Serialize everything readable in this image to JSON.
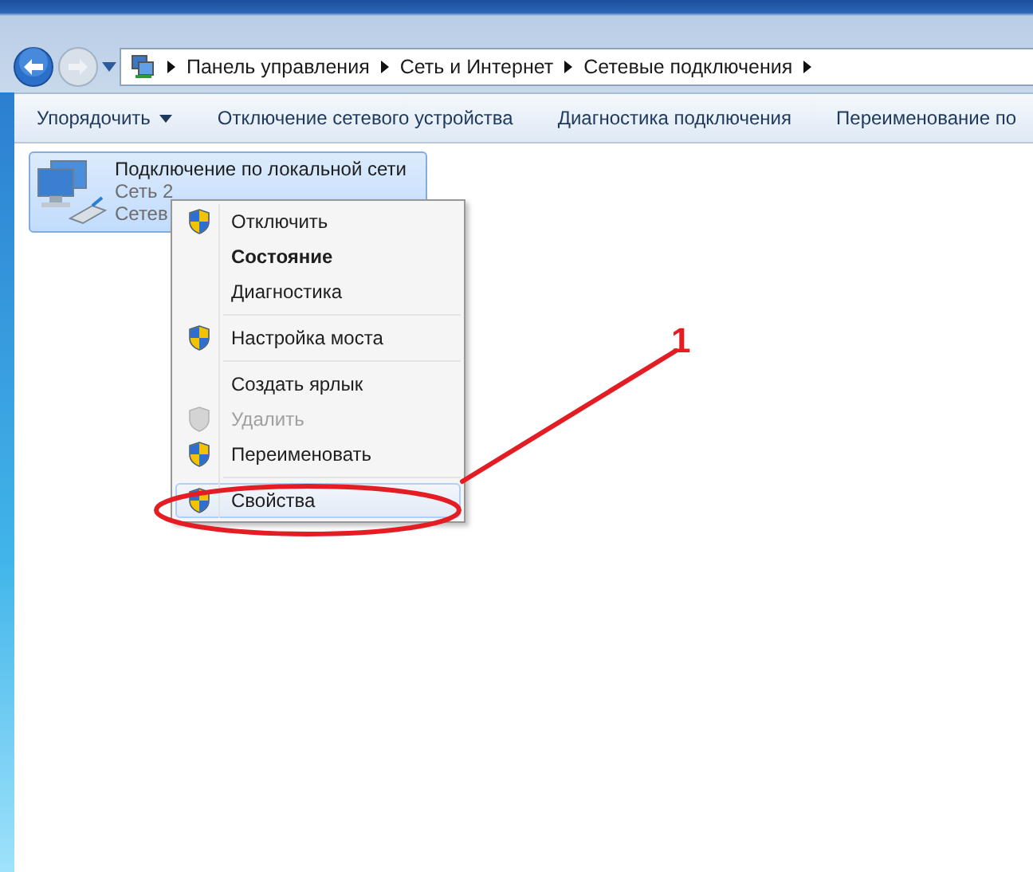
{
  "address_bar": {
    "breadcrumbs": [
      "Панель управления",
      "Сеть и Интернет",
      "Сетевые подключения"
    ]
  },
  "toolbar": {
    "buttons": [
      {
        "label": "Упорядочить",
        "dropdown": true
      },
      {
        "label": "Отключение сетевого устройства",
        "dropdown": false
      },
      {
        "label": "Диагностика подключения",
        "dropdown": false
      },
      {
        "label": "Переименование по",
        "dropdown": false
      }
    ]
  },
  "connection": {
    "name": "Подключение по локальной сети",
    "network": "Сеть  2",
    "detail": "Сетев",
    "selected": true
  },
  "context_menu": {
    "groups": [
      [
        {
          "label": "Отключить",
          "kind": "shield",
          "bold": false,
          "disabled": false,
          "selected": false
        },
        {
          "label": "Состояние",
          "kind": "plain",
          "bold": true,
          "disabled": false,
          "selected": false
        },
        {
          "label": "Диагностика",
          "kind": "plain",
          "bold": false,
          "disabled": false,
          "selected": false
        }
      ],
      [
        {
          "label": "Настройка моста",
          "kind": "shield",
          "bold": false,
          "disabled": false,
          "selected": false
        }
      ],
      [
        {
          "label": "Создать ярлык",
          "kind": "plain",
          "bold": false,
          "disabled": false,
          "selected": false
        },
        {
          "label": "Удалить",
          "kind": "shield",
          "bold": false,
          "disabled": true,
          "selected": false
        },
        {
          "label": "Переименовать",
          "kind": "shield",
          "bold": false,
          "disabled": false,
          "selected": false
        }
      ],
      [
        {
          "label": "Свойства",
          "kind": "shield",
          "bold": false,
          "disabled": false,
          "selected": true
        }
      ]
    ]
  },
  "annotation": {
    "label": "1"
  }
}
